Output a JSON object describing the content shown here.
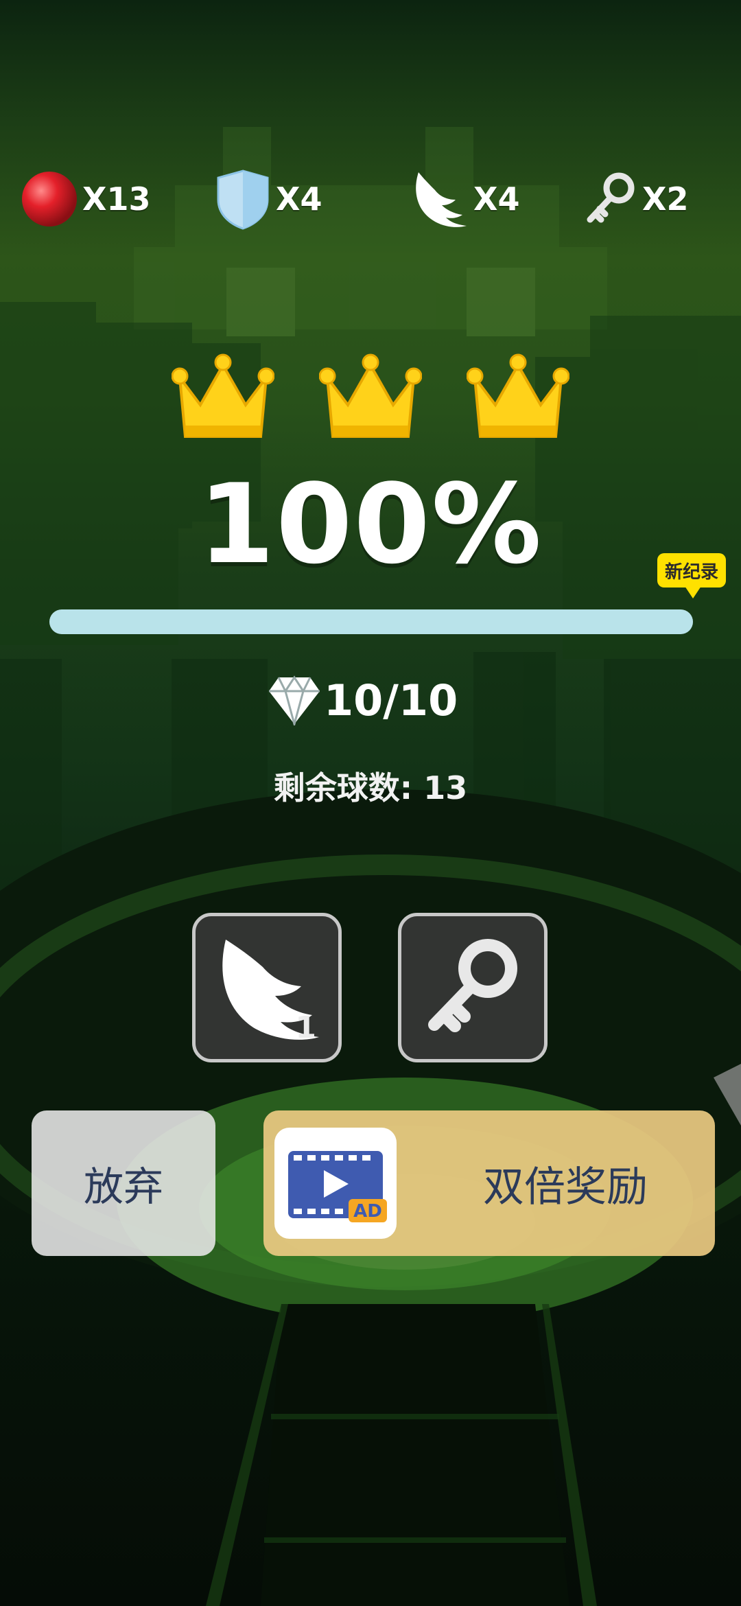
{
  "resources": [
    {
      "icon": "red-ball-icon",
      "count": "X13"
    },
    {
      "icon": "shield-icon",
      "count": "X4"
    },
    {
      "icon": "wing-icon",
      "count": "X4"
    },
    {
      "icon": "key-icon",
      "count": "X2"
    }
  ],
  "crowns_earned": 3,
  "result": {
    "percent_text": "100%",
    "progress_fraction": 1.0,
    "new_record_label": "新纪录",
    "gems_text": "10/10",
    "balls_left_text": "剩余球数: 13"
  },
  "items": {
    "wing_count": "1"
  },
  "buttons": {
    "give_up_label": "放弃",
    "double_reward_label": "双倍奖励",
    "ad_tag": "AD"
  },
  "colors": {
    "accent_gold": "#ffd400",
    "progress": "#b9e3ea",
    "reward_button": "#ecca82",
    "button_text": "#2b3a5a"
  }
}
